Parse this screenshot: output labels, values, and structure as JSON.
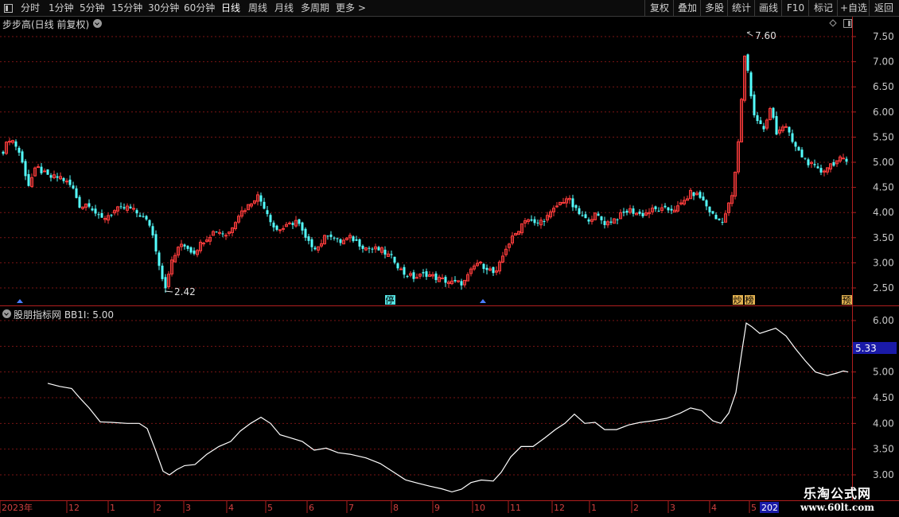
{
  "toolbar": {
    "periods": [
      "分时",
      "1分钟",
      "5分钟",
      "15分钟",
      "30分钟",
      "60分钟",
      "日线",
      "周线",
      "月线",
      "多周期",
      "更多"
    ],
    "active_period": "日线",
    "right_buttons": [
      "复权",
      "叠加",
      "多股",
      "统计",
      "画线",
      "F10",
      "标记",
      "+自选",
      "返回"
    ]
  },
  "main_panel": {
    "title": "步步高(日线 前复权)",
    "y_ticks": [
      "7.50",
      "7.00",
      "6.50",
      "6.00",
      "5.50",
      "5.00",
      "4.50",
      "4.00",
      "3.50",
      "3.00",
      "2.50"
    ],
    "high_label": "7.60",
    "low_label": "2.42",
    "markers": [
      "停",
      "炒",
      "榜",
      "预"
    ]
  },
  "indicator_panel": {
    "title": "股朋指标网 BB1I: 5.00",
    "y_ticks": [
      "6.00",
      "5.50",
      "5.00",
      "4.50",
      "4.00",
      "3.50",
      "3.00"
    ],
    "current_value": "5.33"
  },
  "date_axis": {
    "labels": [
      "2023年",
      "12",
      "1",
      "2",
      "3",
      "4",
      "5",
      "6",
      "7",
      "8",
      "9",
      "10",
      "11",
      "12",
      "1",
      "2",
      "3",
      "4",
      "5"
    ],
    "highlight": "202"
  },
  "watermark": {
    "line1": "乐淘公式网",
    "line2": "www.60lt.com"
  },
  "colors": {
    "up": "#ff3c3c",
    "down": "#54ffff",
    "line": "#ffffff",
    "axis": "#b01e1e",
    "grid": "#7a1414",
    "highlight_bg": "#1a1aa8"
  }
}
